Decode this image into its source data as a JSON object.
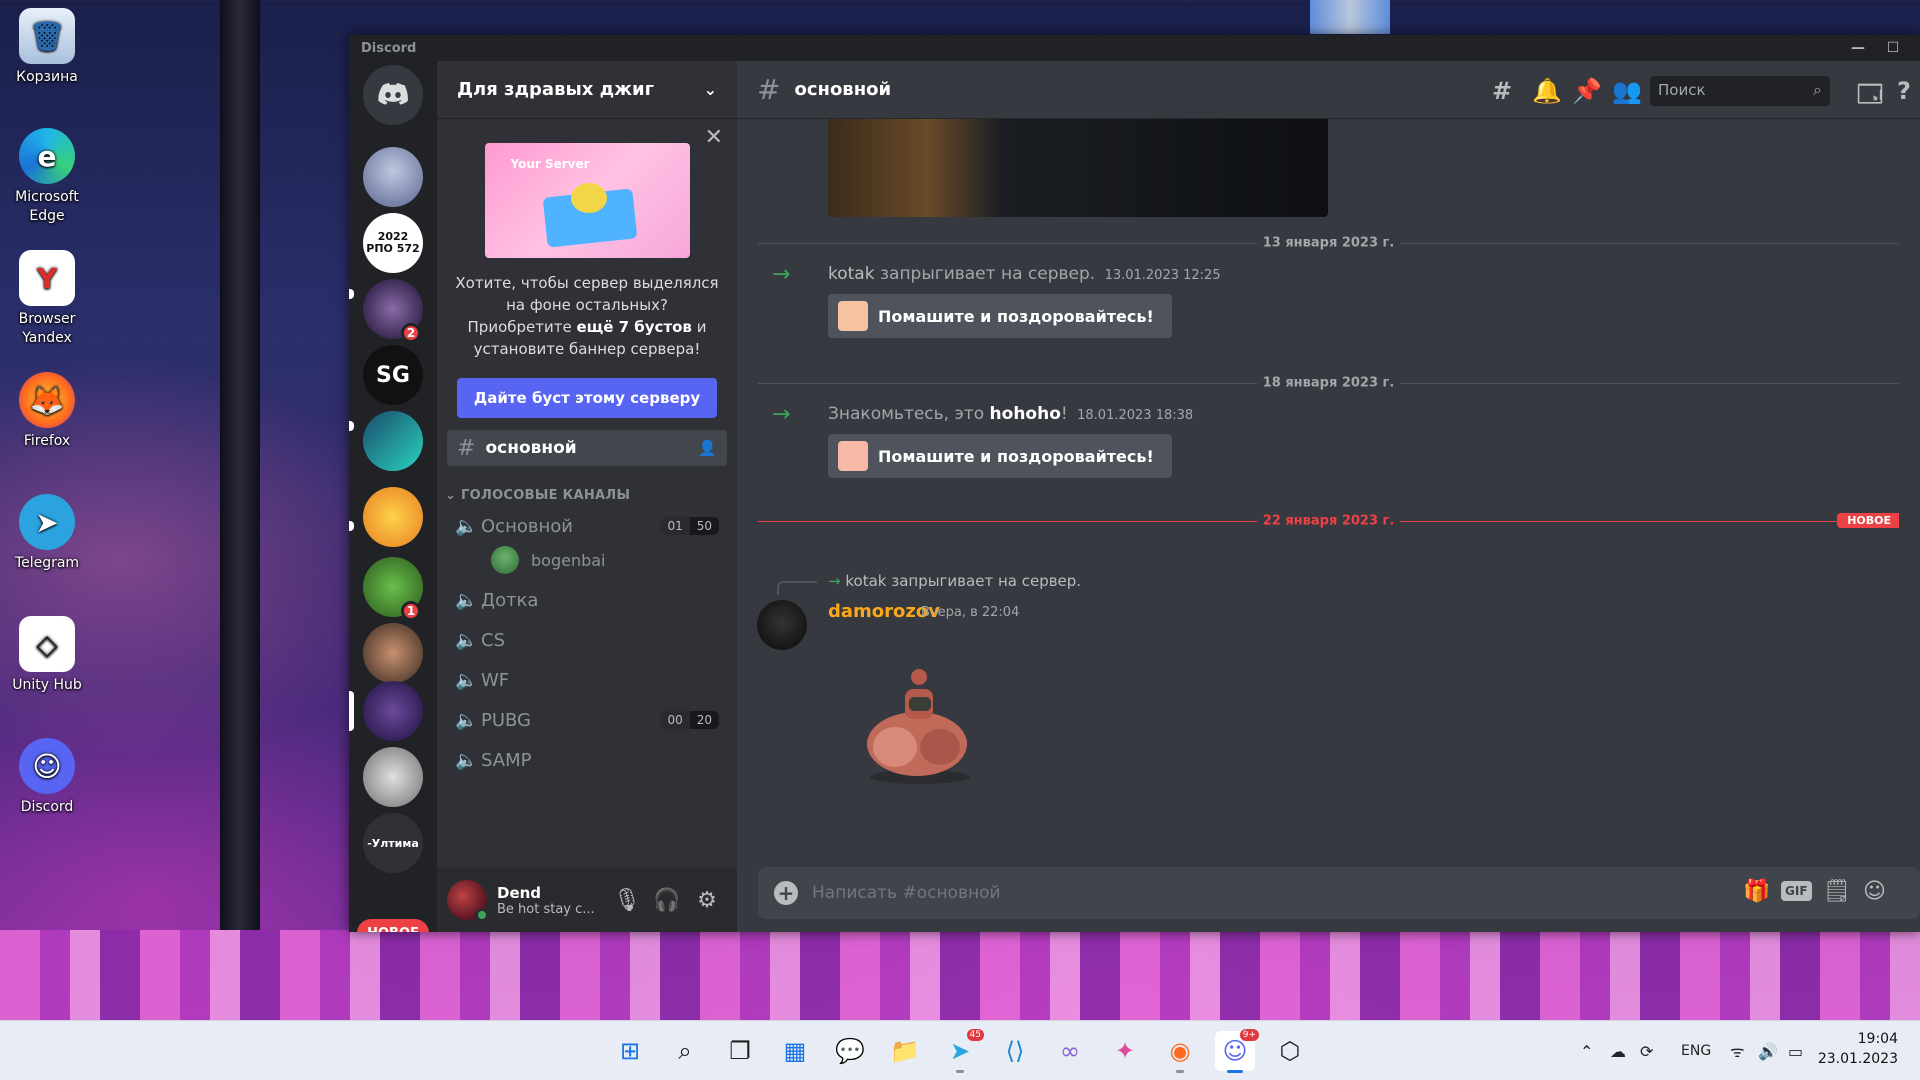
{
  "desktop": {
    "icons": [
      {
        "label": "Корзина",
        "icon": "recycle-bin-icon",
        "glyph": "🗑"
      },
      {
        "label": "Microsoft Edge",
        "icon": "edge-icon",
        "glyph": "e"
      },
      {
        "label": "Browser Yandex",
        "icon": "yandex-icon",
        "glyph": "Y"
      },
      {
        "label": "Firefox",
        "icon": "firefox-icon",
        "glyph": "🦊"
      },
      {
        "label": "Telegram",
        "icon": "telegram-icon",
        "glyph": "➤"
      },
      {
        "label": "Unity Hub",
        "icon": "unity-icon",
        "glyph": "◇"
      },
      {
        "label": "Discord",
        "icon": "discord-icon",
        "glyph": "☺"
      }
    ]
  },
  "window": {
    "title": "Discord",
    "minimize": "—",
    "maximize": "☐"
  },
  "servers": {
    "items": [
      {
        "name": "home",
        "text": "",
        "badge": ""
      },
      {
        "name": "server-1",
        "text": "",
        "badge": ""
      },
      {
        "name": "server-rpo",
        "text": "2022 РПО 572",
        "badge": ""
      },
      {
        "name": "server-3",
        "text": "",
        "badge": "2"
      },
      {
        "name": "server-csgo",
        "text": "SG",
        "badge": ""
      },
      {
        "name": "server-5",
        "text": "",
        "badge": ""
      },
      {
        "name": "server-6",
        "text": "",
        "badge": ""
      },
      {
        "name": "server-7",
        "text": "",
        "badge": "1"
      },
      {
        "name": "server-8",
        "text": "",
        "badge": ""
      },
      {
        "name": "server-9",
        "text": "",
        "badge": ""
      },
      {
        "name": "server-10",
        "text": "",
        "badge": ""
      },
      {
        "name": "server-11",
        "text": "-Ултима",
        "badge": ""
      }
    ],
    "new_label": "НОВОЕ"
  },
  "guild": {
    "name": "Для здравых джиг",
    "boost": {
      "image_caption": "Your Server",
      "text_before": "Хотите, чтобы сервер выделялся на фоне остальных? Приобретите ",
      "text_bold": "ещё 7 бустов",
      "text_after": " и установите баннер сервера!",
      "button": "Дайте буст этому серверу"
    },
    "active_channel": "основной",
    "voice_category": "ГОЛОСОВЫЕ КАНАЛЫ",
    "voice_channels": [
      {
        "name": "Основной",
        "cap_a": "01",
        "cap_b": "50",
        "users": [
          "bogenbai"
        ]
      },
      {
        "name": "Дотка",
        "cap_a": "",
        "cap_b": "",
        "users": []
      },
      {
        "name": "CS",
        "cap_a": "",
        "cap_b": "",
        "users": []
      },
      {
        "name": "WF",
        "cap_a": "",
        "cap_b": "",
        "users": []
      },
      {
        "name": "PUBG",
        "cap_a": "00",
        "cap_b": "20",
        "users": []
      },
      {
        "name": "SAMP",
        "cap_a": "",
        "cap_b": "",
        "users": []
      }
    ]
  },
  "user": {
    "name": "Dend",
    "status": "Be hot stay c..."
  },
  "chat": {
    "channel": "основной",
    "search_placeholder": "Поиск",
    "dividers": [
      "13 января 2023 г.",
      "18 января 2023 г.",
      "22 января 2023 г."
    ],
    "new_tag": "НОВОЕ",
    "join1": {
      "user": "kotak",
      "text": " запрыгивает на сервер.",
      "ts": "13.01.2023 12:25"
    },
    "join2": {
      "prefix": "Знакомьтесь, это ",
      "user": "hohoho",
      "suffix": "!",
      "ts": "18.01.2023 18:38"
    },
    "wave_label": "Помашите и поздоровайтесь!",
    "reply": "kotak запрыгивает на сервер.",
    "author": "damorozov",
    "author_ts": "Вчера, в 22:04",
    "composer_placeholder": "Написать #основной",
    "gif_label": "GIF"
  },
  "taskbar": {
    "lang": "ENG",
    "time": "19:04",
    "date": "23.01.2023",
    "telegram_badge": "45",
    "discord_badge": "9+"
  },
  "colors": {
    "blurple": "#5865f2",
    "red": "#ed4245",
    "green": "#3ba55d",
    "author": "#faa81a"
  }
}
